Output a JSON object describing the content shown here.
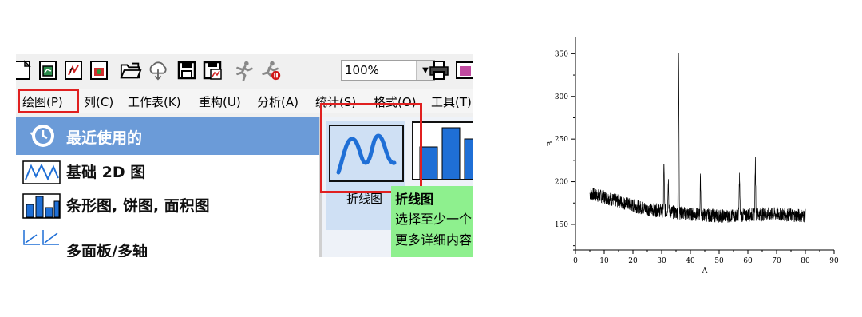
{
  "toolbar": {
    "icons": [
      "new-worksheet-icon",
      "new-graph-icon",
      "new-function-icon",
      "new-layout-icon",
      "open-folder-icon",
      "cloud-icon",
      "save-icon",
      "save-template-icon",
      "recalculate-icon",
      "stop-recalculate-icon",
      "print-icon",
      "export-icon"
    ],
    "zoom_value": "100%"
  },
  "menubar": {
    "items": [
      "绘图(P)",
      "列(C)",
      "工作表(K)",
      "重构(U)",
      "分析(A)",
      "统计(S)",
      "格式(O)",
      "工具(T)"
    ]
  },
  "categories": {
    "header": "最近使用的",
    "items": [
      "基础 2D 图",
      "条形图, 饼图, 面积图",
      "多面板/多轴"
    ]
  },
  "gallery": {
    "tile_label": "折线图"
  },
  "tooltip": {
    "title": "折线图",
    "lines": [
      "选择至少一个",
      "更多详细内容"
    ]
  },
  "colors": {
    "highlight": "#e02020",
    "category_header": "#6b9bd8",
    "tooltip": "#8ef08e",
    "line_icon": "#1f6fd6"
  },
  "chart_data": {
    "type": "line",
    "xlabel": "A",
    "ylabel": "B",
    "xlim": [
      0,
      90
    ],
    "ylim": [
      120,
      370
    ],
    "xticks": [
      0,
      10,
      20,
      30,
      40,
      50,
      60,
      70,
      80,
      90
    ],
    "yticks": [
      150,
      200,
      250,
      300,
      350
    ],
    "grid": false,
    "baseline": [
      [
        5,
        186
      ],
      [
        10,
        182
      ],
      [
        15,
        177
      ],
      [
        20,
        172
      ],
      [
        25,
        168
      ],
      [
        30,
        166
      ],
      [
        35,
        164
      ],
      [
        40,
        162
      ],
      [
        45,
        161
      ],
      [
        50,
        160
      ],
      [
        55,
        160
      ],
      [
        60,
        161
      ],
      [
        65,
        162
      ],
      [
        70,
        162
      ],
      [
        75,
        161
      ],
      [
        80,
        160
      ]
    ],
    "peaks": [
      [
        30.8,
        220
      ],
      [
        32.3,
        205
      ],
      [
        35.9,
        347
      ],
      [
        43.5,
        202
      ],
      [
        57.1,
        206
      ],
      [
        62.6,
        222
      ]
    ],
    "x_range": [
      5,
      80
    ],
    "noise_amplitude": 8
  }
}
